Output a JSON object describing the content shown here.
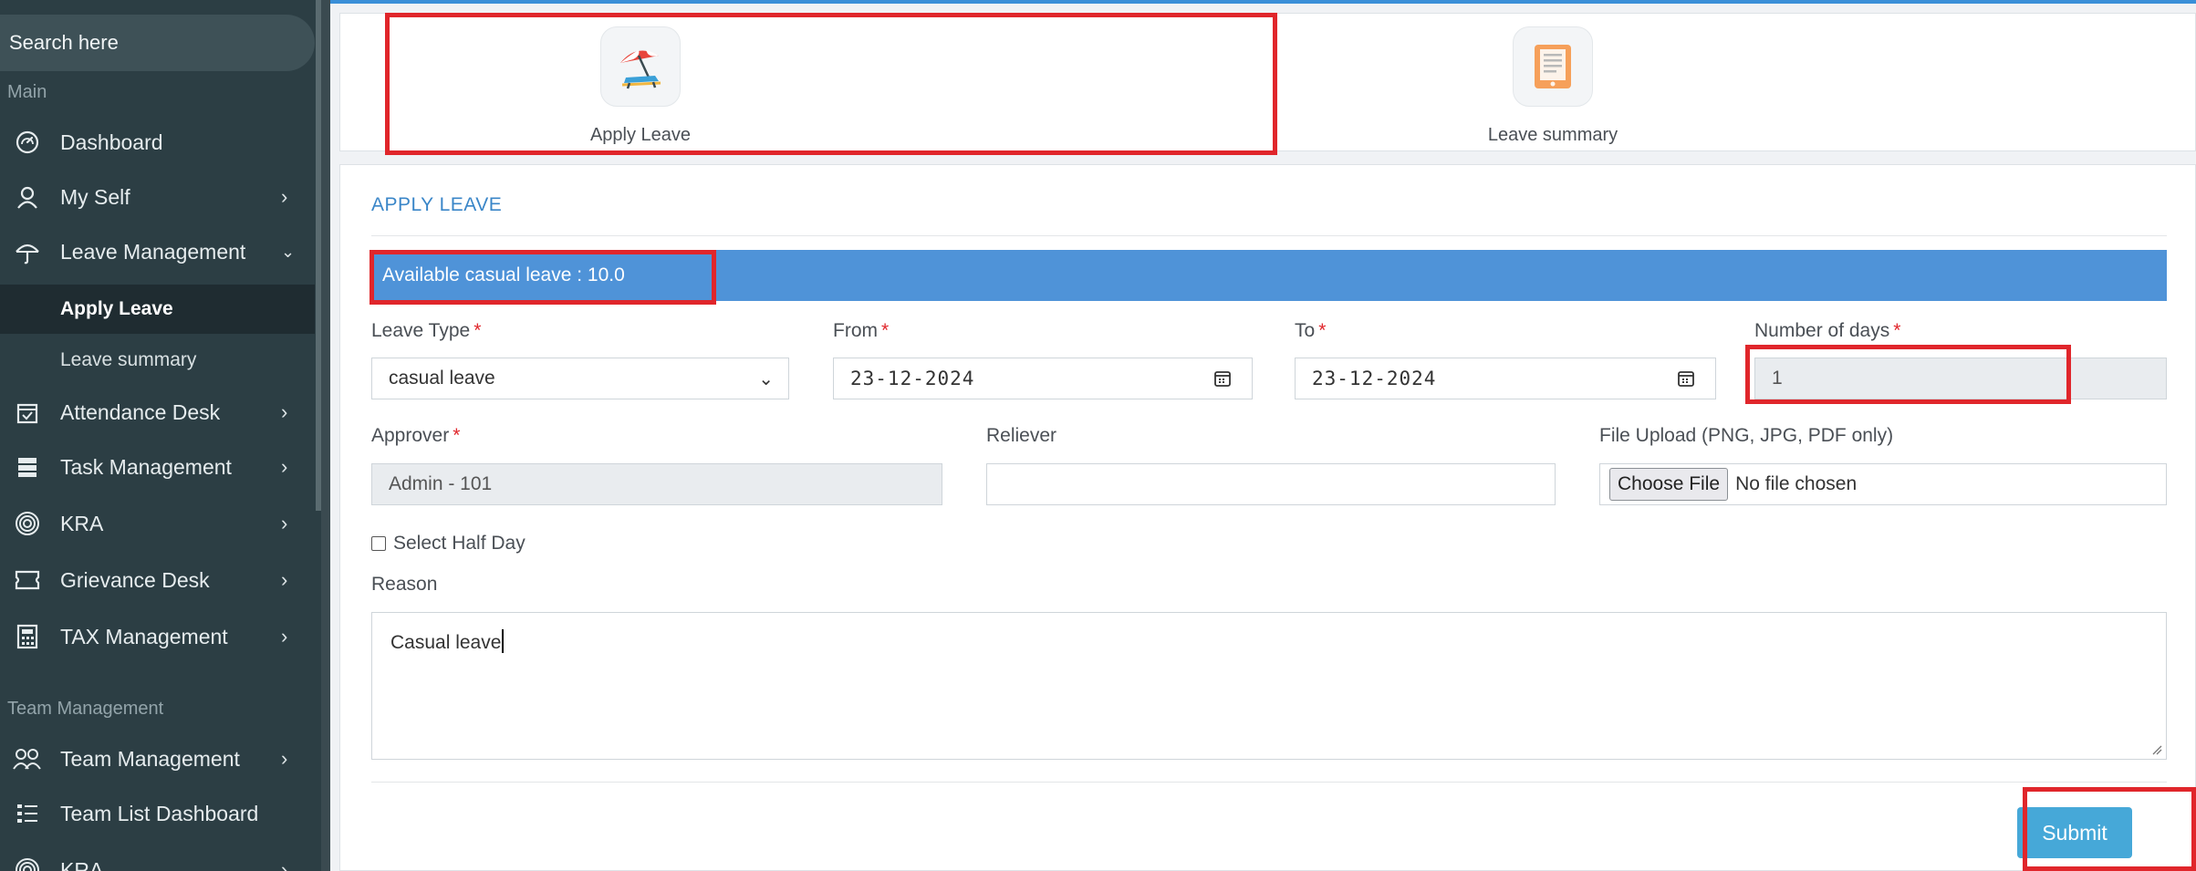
{
  "sidebar": {
    "search_placeholder": "Search here",
    "section_main": "Main",
    "section_team": "Team Management",
    "items": [
      {
        "label": "Dashboard",
        "icon": "dashboard-gauge-icon"
      },
      {
        "label": "My Self",
        "icon": "user-icon"
      },
      {
        "label": "Leave Management",
        "icon": "umbrella-icon"
      },
      {
        "label": "Attendance Desk",
        "icon": "calendar-check-icon"
      },
      {
        "label": "Task Management",
        "icon": "server-stack-icon"
      },
      {
        "label": "KRA",
        "icon": "target-icon"
      },
      {
        "label": "Grievance Desk",
        "icon": "ticket-icon"
      },
      {
        "label": "TAX Management",
        "icon": "calculator-icon"
      },
      {
        "label": "Team Management",
        "icon": "users-icon"
      },
      {
        "label": "Team List Dashboard",
        "icon": "list-icon"
      },
      {
        "label": "KRA",
        "icon": "target-icon"
      }
    ],
    "sub_items": [
      {
        "label": "Apply Leave",
        "active": true
      },
      {
        "label": "Leave summary",
        "active": false
      }
    ]
  },
  "tabs": [
    {
      "label": "Apply Leave",
      "icon": "beach-umbrella-icon"
    },
    {
      "label": "Leave summary",
      "icon": "document-list-icon"
    }
  ],
  "form": {
    "title": "APPLY LEAVE",
    "available": "Available casual leave : 10.0",
    "leave_type_label": "Leave Type",
    "leave_type_value": "casual leave",
    "from_label": "From",
    "from_value": "23-12-2024",
    "to_label": "To",
    "to_value": "23-12-2024",
    "days_label": "Number of days",
    "days_value": "1",
    "approver_label": "Approver",
    "approver_value": "Admin - 101",
    "reliever_label": "Reliever",
    "reliever_value": "",
    "upload_label": "File Upload (PNG, JPG, PDF only)",
    "choose_file": "Choose File",
    "no_file": "No file chosen",
    "half_day_label": "Select Half Day",
    "reason_label": "Reason",
    "reason_value": "Casual leave",
    "submit": "Submit",
    "required_mark": "*"
  },
  "colors": {
    "sidebar_bg": "#2c3e44",
    "accent_blue": "#4f93d8",
    "highlight_red": "#e0262b",
    "submit_bg": "#46a8d8"
  }
}
